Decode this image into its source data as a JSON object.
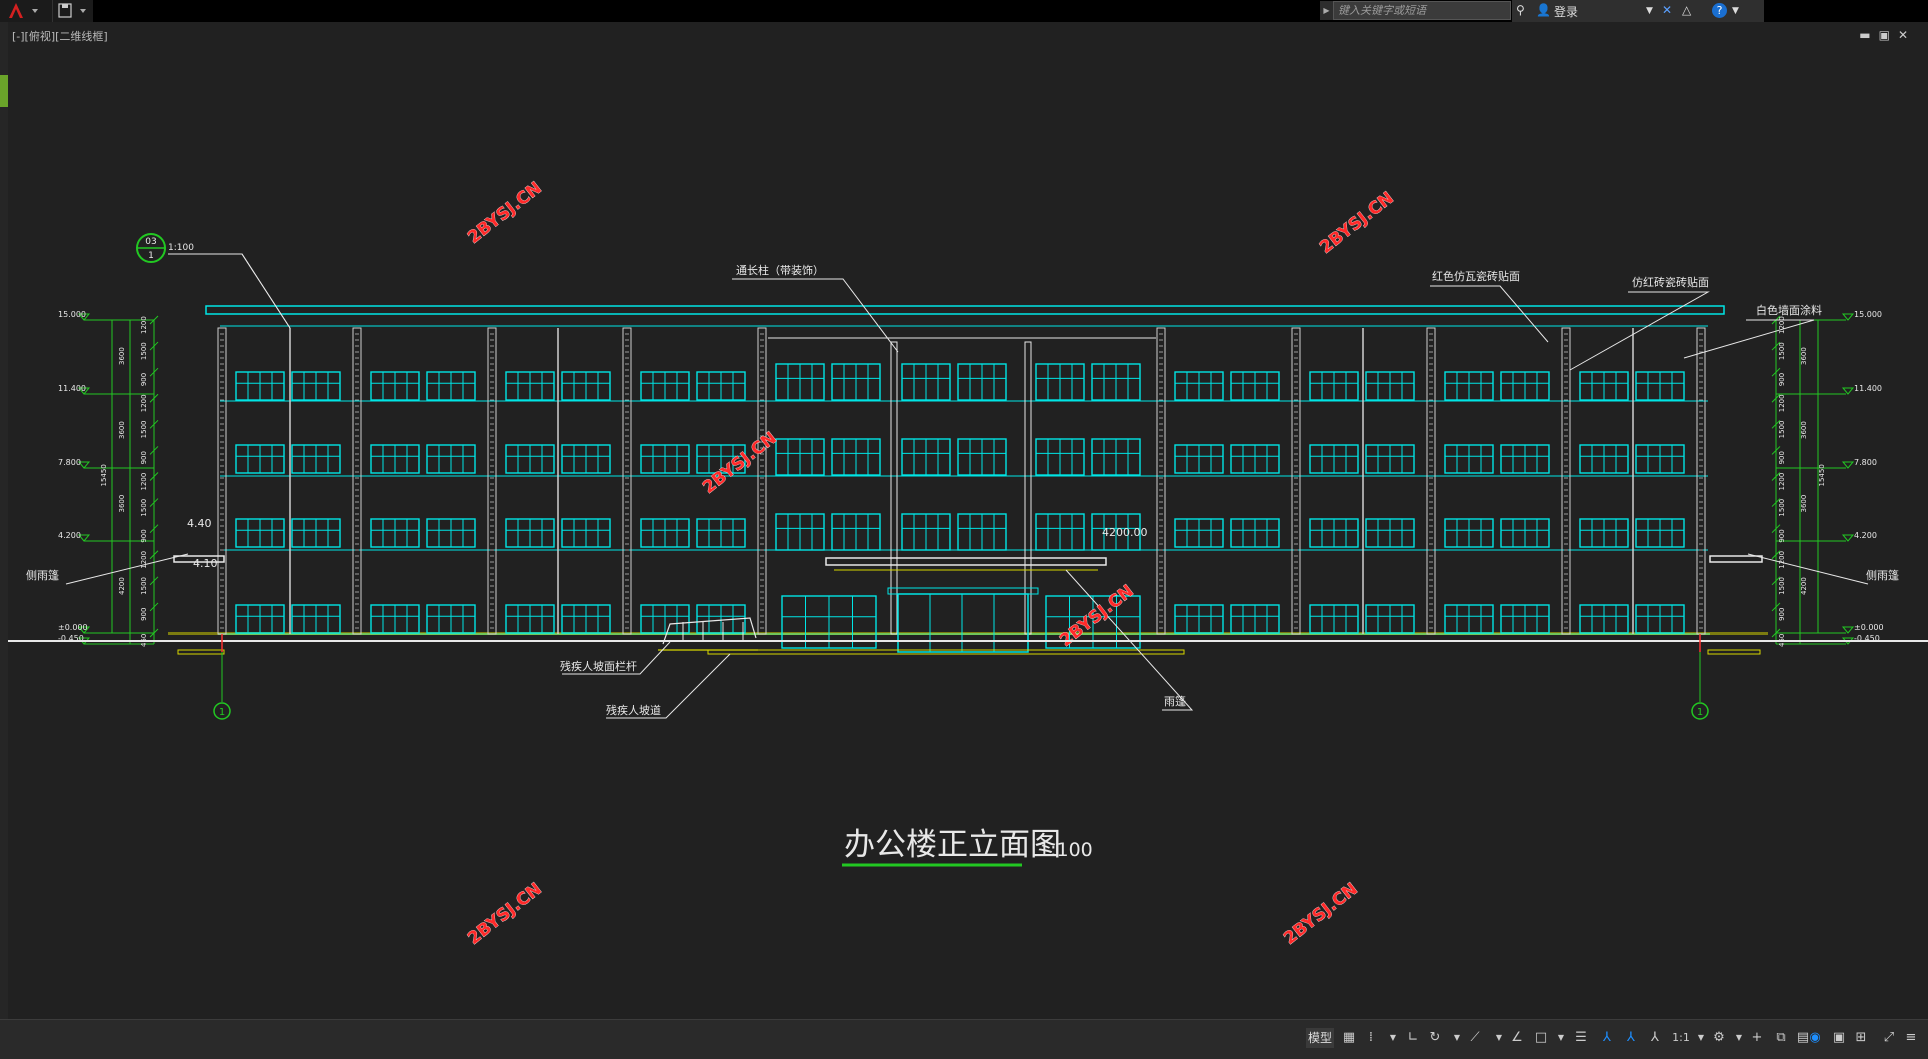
{
  "app": {
    "search_placeholder": "键入关键字或短语",
    "login_label": "登录",
    "viewport_tab": "[-][俯视][二维线框]"
  },
  "drawing": {
    "title": "办公楼正立面图",
    "title_scale": "1:100",
    "callout_top": "03",
    "callout_bottom": "1",
    "callout_scale": "1:100",
    "grid_mark_left": "1",
    "grid_mark_right": "1",
    "watermark": "2BYSJ.CN",
    "canopy_level": "4200.00",
    "side_canopy_top": "4.40",
    "side_canopy_bottom": "4.10",
    "annotations": {
      "pilaster": "通长柱（带装饰）",
      "red_tile": "红色仿瓦瓷砖贴面",
      "imitation_red_brick": "仿红砖瓷砖贴面",
      "white_paint": "白色墙面涂料",
      "side_canopy_left": "侧雨篷",
      "side_canopy_right": "侧雨篷",
      "ramp_railing": "残疾人坡面栏杆",
      "ramp": "残疾人坡道",
      "canopy": "雨篷"
    },
    "levels_left": [
      "15.000",
      "11.400",
      "7.800",
      "4.200",
      "±0.000",
      "-0.450"
    ],
    "levels_right": [
      "15.000",
      "11.400",
      "7.800",
      "4.200",
      "±0.000",
      "-0.450"
    ],
    "dims_inner": [
      "1200",
      "1500",
      "900",
      "1200",
      "1500",
      "900",
      "1200",
      "1500",
      "900",
      "1200",
      "1500",
      "900",
      "450"
    ],
    "dims_outer": [
      "3600",
      "3600",
      "3600",
      "4200"
    ],
    "dim_total": "15450"
  },
  "statusbar": {
    "model_label": "模型",
    "scale_label": "1:1"
  },
  "colors": {
    "background": "#212121",
    "cyan": "#00e5e5",
    "white": "#e8e8e8",
    "green": "#22c822",
    "yellow": "#d8d800",
    "red_watermark": "#ff2a2a"
  }
}
